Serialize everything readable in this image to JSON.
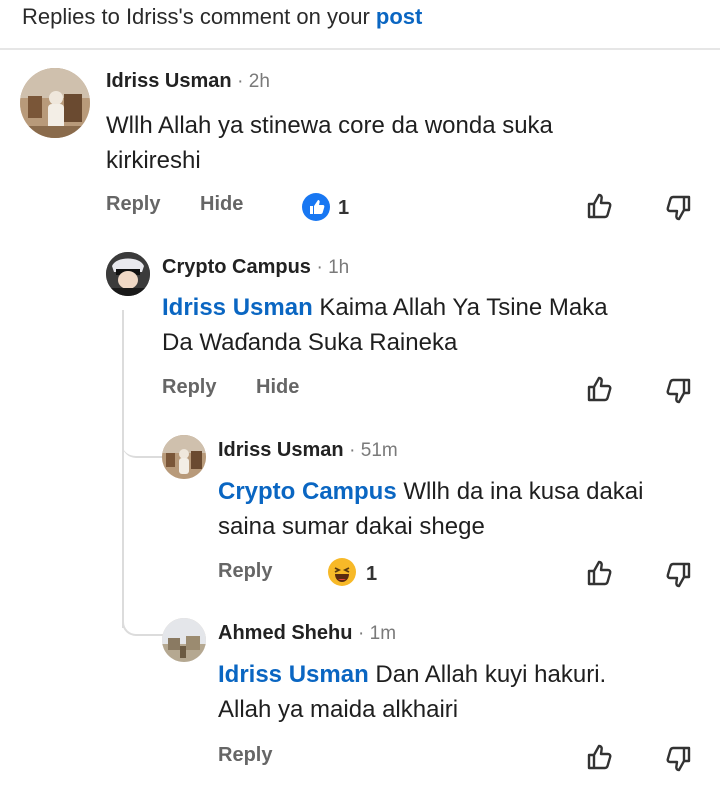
{
  "header": {
    "prefix": "Replies to Idriss's comment on your ",
    "link": "post"
  },
  "comments": [
    {
      "name": "Idriss Usman",
      "time": "· 2h",
      "mention": "",
      "text_line1": "Wllh Allah ya stinewa core da wonda suka",
      "text_line2": "kirkireshi",
      "reply": "Reply",
      "hide": "Hide",
      "reaction_count": "1",
      "reaction": "like-icon"
    },
    {
      "name": "Crypto Campus",
      "time": "· 1h",
      "mention": "Idriss Usman",
      "text_line1": "Kaima Allah Ya Tsine Maka",
      "text_line2": "Da Waɗanda Suka Raineka",
      "reply": "Reply",
      "hide": "Hide"
    },
    {
      "name": "Idriss Usman",
      "time": "· 51m",
      "mention": "Crypto Campus",
      "text_line1": "Wllh da ina kusa dakai",
      "text_line2": "saina sumar dakai shege",
      "reply": "Reply",
      "reaction_count": "1",
      "reaction": "haha-icon"
    },
    {
      "name": "Ahmed Shehu",
      "time": "· 1m",
      "mention": "Idriss Usman",
      "text_line1": "Dan Allah kuyi hakuri.",
      "text_line2": "Allah ya maida alkhairi",
      "reply": "Reply"
    }
  ],
  "colors": {
    "accent": "#0a66c2",
    "muted": "#7a7a7a"
  }
}
